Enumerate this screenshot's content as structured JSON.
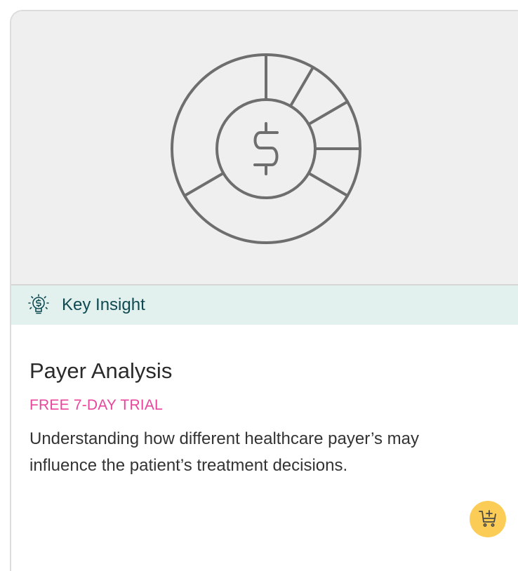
{
  "card": {
    "badge_label": "Key Insight",
    "title": "Payer Analysis",
    "trial_label": "FREE 7-DAY TRIAL",
    "description": "Understanding how different healthcare payer’s may influence the patient’s treatment decisions."
  },
  "icons": {
    "hero": "dollar-pie-chart-icon",
    "badge": "lightbulb-dollar-icon",
    "cart": "add-to-cart-icon"
  },
  "colors": {
    "hero_background": "#efefef",
    "insight_background": "#e2f1ee",
    "insight_text": "#0f4a52",
    "trial_text": "#e8459b",
    "cart_button": "#fbcd57",
    "icon_stroke": "#6e6e6e"
  }
}
